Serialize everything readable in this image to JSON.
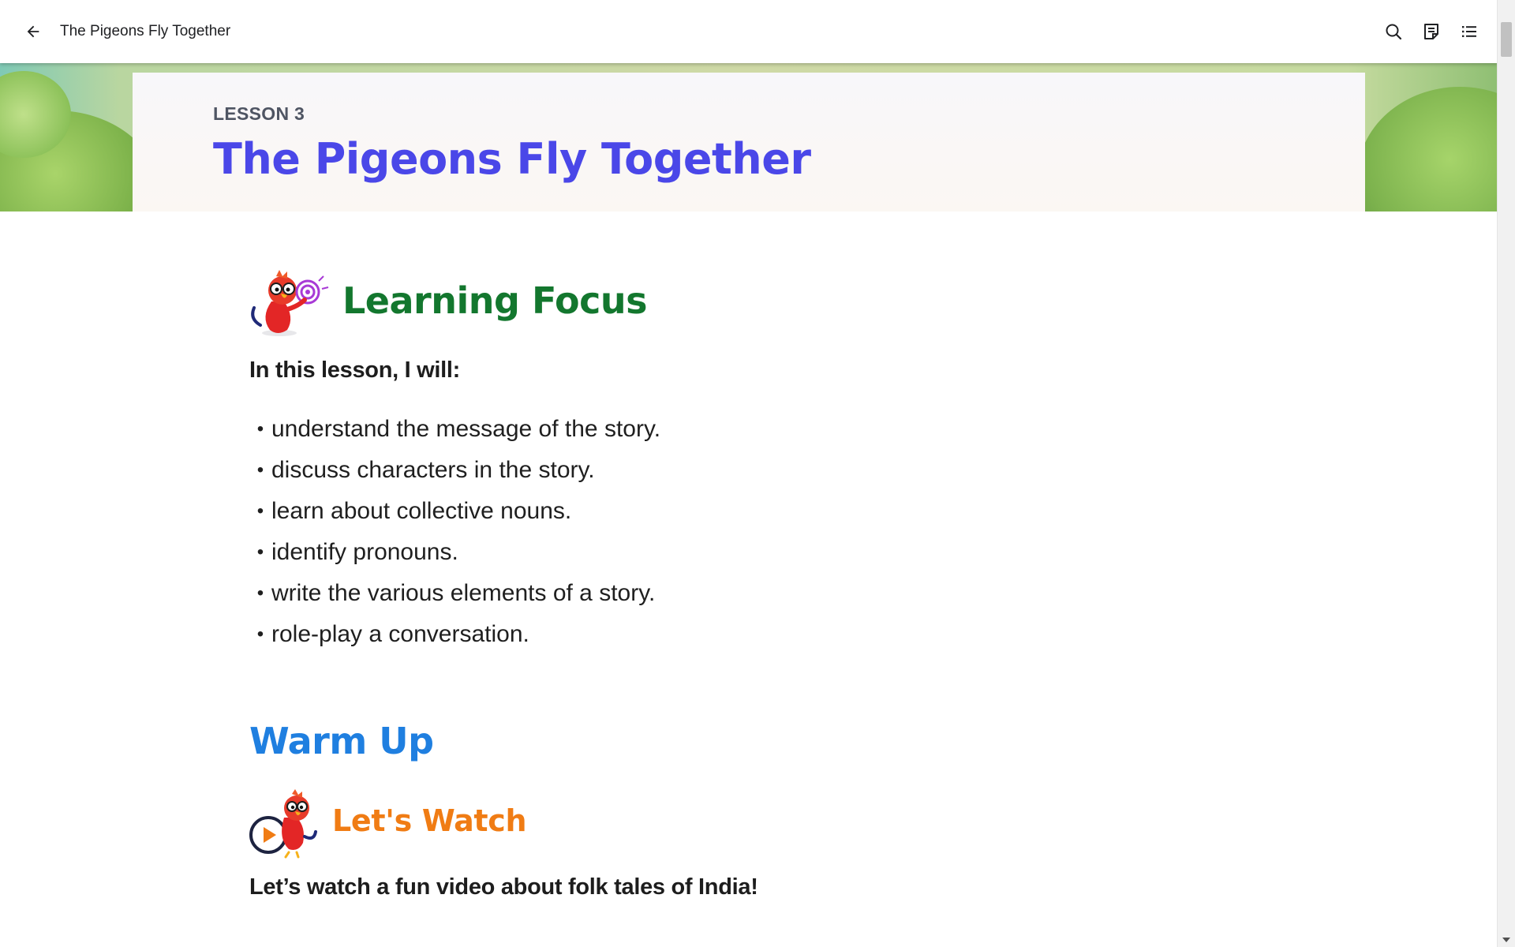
{
  "appbar": {
    "title": "The Pigeons Fly Together",
    "back_icon": "arrow-left-icon",
    "search_icon": "search-icon",
    "notes_icon": "notes-icon",
    "toc_icon": "list-icon"
  },
  "banner": {
    "lesson_number": "LESSON 3",
    "lesson_title": "The Pigeons Fly Together"
  },
  "learning_focus": {
    "heading": "Learning Focus",
    "intro": "In this lesson, I will:",
    "bullet": "•",
    "goals": [
      "understand the message of the story.",
      "discuss characters in the story.",
      "learn about collective nouns.",
      "identify pronouns.",
      "write the various elements of a story.",
      "role-play a conversation."
    ]
  },
  "warm_up": {
    "heading": "Warm Up",
    "watch_heading": "Let's Watch",
    "watch_text": "Let’s watch a fun video about folk tales of India!"
  },
  "colors": {
    "title_purple": "#4a47e8",
    "focus_green": "#13772e",
    "warmup_blue": "#1f7fe0",
    "watch_orange": "#f07c14"
  }
}
